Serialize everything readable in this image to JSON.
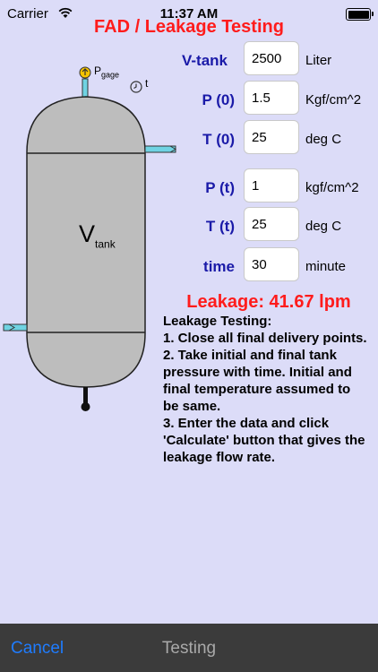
{
  "status_bar": {
    "carrier": "Carrier",
    "time": "11:37 AM"
  },
  "header": {
    "title": "FAD / Leakage Testing"
  },
  "diagram": {
    "p_gage_main": "P",
    "p_gage_sub": "gage",
    "t_label": "t",
    "v_main": "V",
    "v_sub": "tank"
  },
  "form": {
    "rows": [
      {
        "label": "V-tank",
        "value": "2500",
        "unit": "Liter"
      },
      {
        "label": "P (0)",
        "value": "1.5",
        "unit": "Kgf/cm^2"
      },
      {
        "label": "T (0)",
        "value": "25",
        "unit": "deg C"
      },
      {
        "label": "P (t)",
        "value": "1",
        "unit": "kgf/cm^2"
      },
      {
        "label": "T (t)",
        "value": "25",
        "unit": "deg C"
      },
      {
        "label": "time",
        "value": "30",
        "unit": "minute"
      }
    ]
  },
  "result": {
    "text": "Leakage: 41.67 lpm"
  },
  "instructions": {
    "heading": "Leakage Testing:",
    "line1": "1.  Close all final delivery points.",
    "line2": "2. Take initial and final tank pressure with time.  Initial and final temperature assumed to be same.",
    "line3": "3. Enter the data and click 'Calculate' button that gives the leakage flow rate."
  },
  "toolbar": {
    "cancel_label": "Cancel",
    "title": "Testing"
  },
  "colors": {
    "background": "#dcdcf8",
    "title_red": "#ff1c1c",
    "label_blue": "#1a1aa8",
    "tank_gray": "#bdbdbd",
    "pipe_cyan": "#6fd3e3",
    "gage_yellow": "#f5c400",
    "toolbar": "#3b3b3b",
    "cancel_blue": "#1f7cff"
  }
}
